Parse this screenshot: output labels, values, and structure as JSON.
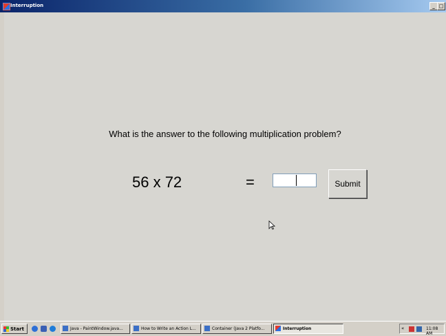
{
  "window": {
    "title": "Interruption",
    "minimize_glyph": "_",
    "maximize_glyph": "□"
  },
  "main": {
    "question": "What is the answer to the following multiplication problem?",
    "problem": "56 x 72",
    "equals": "=",
    "answer_value": "",
    "submit_label": "Submit"
  },
  "taskbar": {
    "start_label": "Start",
    "tasks": [
      {
        "label": "Java - PaintWindow.java...",
        "icon": "eclipse-icon"
      },
      {
        "label": "How to Write an Action L...",
        "icon": "ie-icon"
      },
      {
        "label": "Container (Java 2 Platfo...",
        "icon": "ie-icon"
      },
      {
        "label": "Interruption",
        "icon": "java-app-icon",
        "active": true
      }
    ],
    "tray_chevron": "«",
    "clock": "11:08 AM"
  }
}
